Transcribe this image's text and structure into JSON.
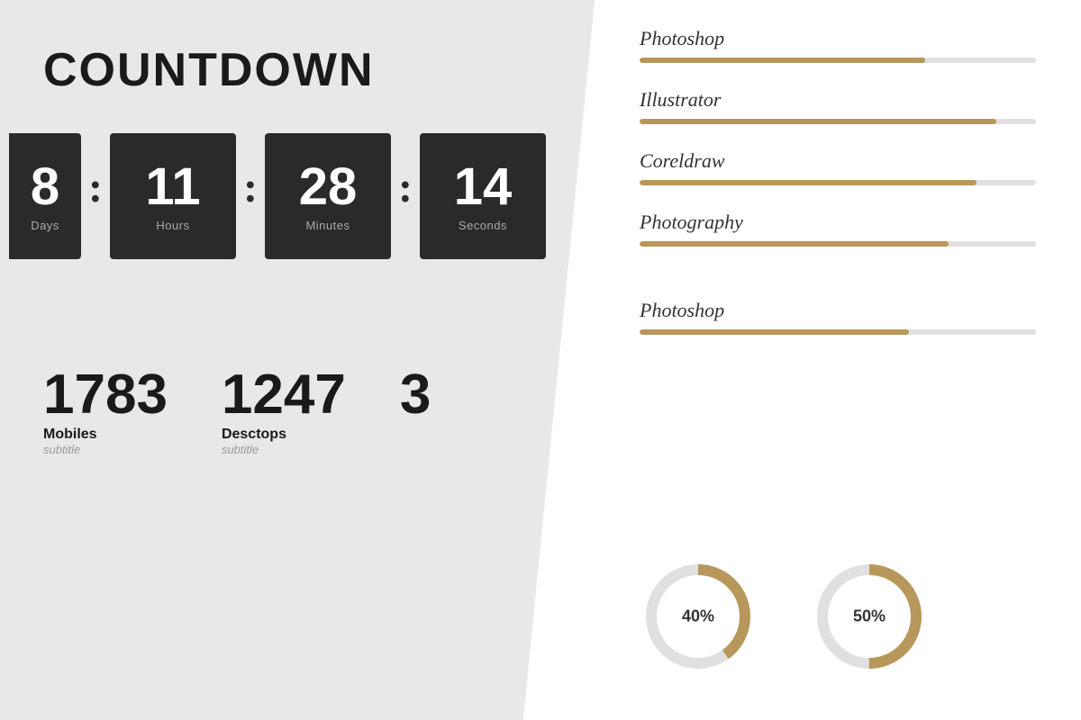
{
  "left": {
    "title": "COUNTDOWN",
    "timer": {
      "days": {
        "value": "8",
        "label": "Days"
      },
      "hours": {
        "value": "11",
        "label": "Hours"
      },
      "minutes": {
        "value": "28",
        "label": "Minutes"
      },
      "seconds": {
        "value": "14",
        "label": "Seconds"
      }
    },
    "stats": [
      {
        "id": "mobiles",
        "number": "1783",
        "title": "Mobiles",
        "subtitle": "subtitle",
        "icon": "mobile"
      },
      {
        "id": "desktops",
        "number": "1247",
        "title": "Desctops",
        "subtitle": "subtitle",
        "icon": "desktop"
      },
      {
        "id": "other",
        "number": "3",
        "title": "",
        "subtitle": "",
        "icon": "other",
        "partial": true
      }
    ]
  },
  "right": {
    "skills": [
      {
        "name": "Photoshop",
        "percent": 72
      },
      {
        "name": "Illustrator",
        "percent": 90
      },
      {
        "name": "Coreldraw",
        "percent": 85
      },
      {
        "name": "Photography",
        "percent": 78
      }
    ],
    "skills2": [
      {
        "name": "Photoshop",
        "percent": 68
      }
    ],
    "donuts": [
      {
        "label": "40%",
        "percent": 40
      },
      {
        "label": "50%",
        "percent": 50
      }
    ]
  }
}
